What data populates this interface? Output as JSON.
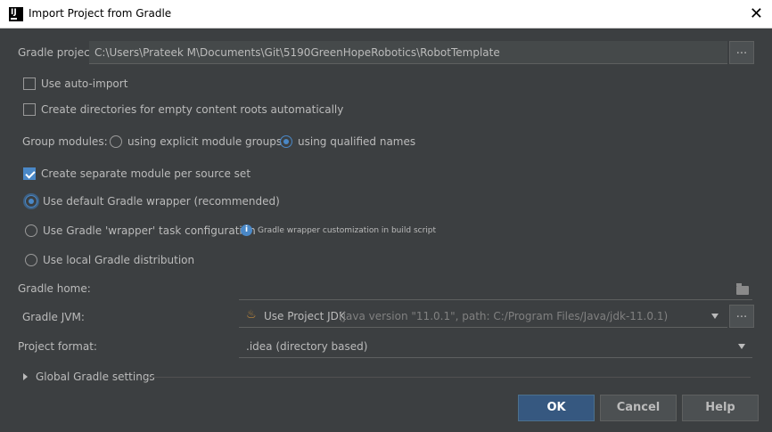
{
  "window": {
    "title": "Import Project from Gradle"
  },
  "gradle_project": {
    "label": "Gradle project:",
    "value": "C:\\Users\\Prateek M\\Documents\\Git\\5190GreenHopeRobotics\\RobotTemplate",
    "browse_label": "..."
  },
  "options": {
    "auto_import": {
      "label": "Use auto-import",
      "checked": false
    },
    "create_dirs": {
      "label": "Create directories for empty content roots automatically",
      "checked": false
    },
    "separate_module": {
      "label": "Create separate module per source set",
      "checked": true
    }
  },
  "group_modules": {
    "label": "Group modules:",
    "explicit_label": "using explicit module groups",
    "qualified_label": "using qualified names",
    "selected": "qualified"
  },
  "distribution": {
    "default_wrapper": "Use default Gradle wrapper (recommended)",
    "wrapper_task": "Use Gradle 'wrapper' task configuration",
    "wrapper_hint": "Gradle wrapper customization in build script",
    "local": "Use local Gradle distribution",
    "selected": "default_wrapper"
  },
  "gradle_home": {
    "label": "Gradle home:",
    "value": ""
  },
  "gradle_jvm": {
    "label": "Gradle JVM:",
    "value": "Use Project JDK",
    "detail": "(java version \"11.0.1\", path: C:/Program Files/Java/jdk-11.0.1)",
    "browse_label": "..."
  },
  "project_format": {
    "label": "Project format:",
    "value": ".idea (directory based)"
  },
  "global_settings": {
    "label": "Global Gradle settings"
  },
  "buttons": {
    "ok": "OK",
    "cancel": "Cancel",
    "help": "Help"
  },
  "colors": {
    "background": "#3c3f41",
    "accent": "#4a88c7",
    "default_button": "#365880"
  }
}
